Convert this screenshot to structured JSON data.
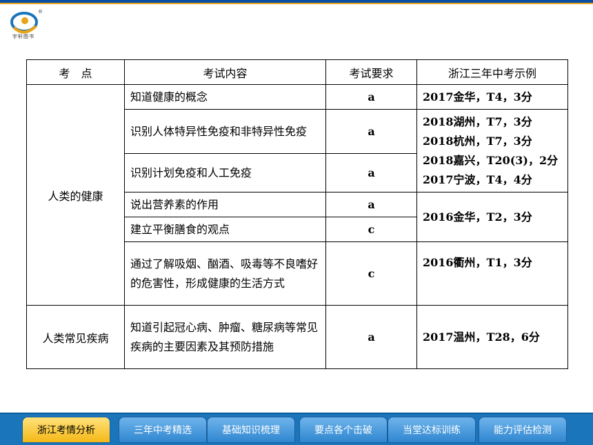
{
  "logo": {
    "caption": "宇轩图书",
    "registered_mark": "®"
  },
  "table": {
    "headers": [
      "考　点",
      "考试内容",
      "考试要求",
      "浙江三年中考示例"
    ],
    "group1": {
      "topic": "人类的健康",
      "rows": [
        {
          "content": "知道健康的概念",
          "req": "a",
          "examples": [
            "2017金华，T4，3分"
          ]
        },
        {
          "content": "识别人体特异性免疫和非特异性免疫",
          "req": "a"
        },
        {
          "content": "识别计划免疫和人工免疫",
          "req": "a"
        },
        {
          "content": "说出营养素的作用",
          "req": "a"
        },
        {
          "content": "建立平衡膳食的观点",
          "req": "c"
        },
        {
          "content": "通过了解吸烟、酗酒、吸毒等不良嗜好的危害性，形成健康的生活方式",
          "req": "c",
          "examples": [
            "2016衢州，T1，3分"
          ]
        }
      ],
      "merged_examples_a": [
        "2018湖州，T7，3分",
        "2018杭州，T7，3分",
        "2018嘉兴，T20(3)，2分",
        "2017宁波，T4，4分"
      ],
      "merged_examples_b": [
        "2016金华，T2，3分"
      ]
    },
    "group2": {
      "topic": "人类常见疾病",
      "rows": [
        {
          "content": "知道引起冠心病、肿瘤、糖尿病等常见疾病的主要因素及其预防措施",
          "req": "a",
          "examples": [
            "2017温州，T28，6分"
          ]
        }
      ]
    }
  },
  "nav": {
    "tabs": [
      {
        "label": "浙江考情分析",
        "active": true
      },
      {
        "label": "三年中考精选",
        "active": false
      },
      {
        "label": "基础知识梳理",
        "active": false
      },
      {
        "label": "要点各个击破",
        "active": false
      },
      {
        "label": "当堂达标训练",
        "active": false
      },
      {
        "label": "能力评估检测",
        "active": false
      }
    ]
  },
  "colors": {
    "nav_bg": "#1b75bb",
    "tab_active": "#f5b817",
    "tab_inactive": "#2f86cf",
    "top_bar": "#0a4fa3"
  }
}
